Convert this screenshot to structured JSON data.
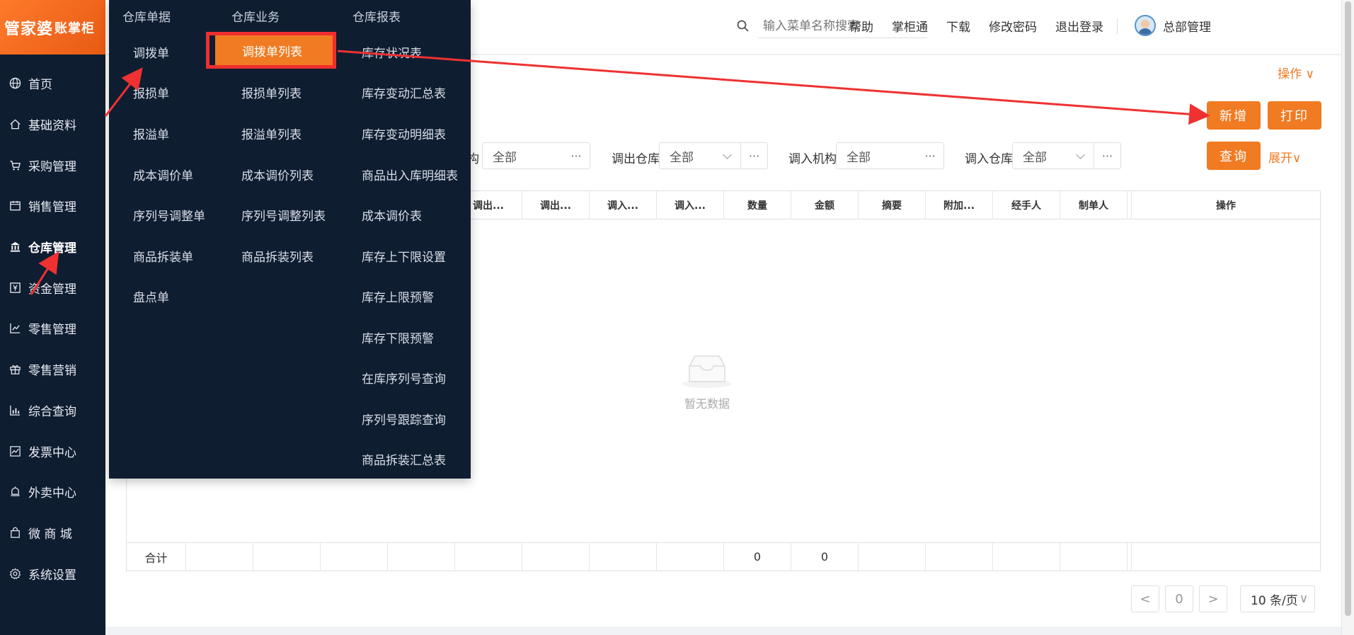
{
  "logo": {
    "main": "管家婆",
    "sub": "账掌柜"
  },
  "sidebar": {
    "items": [
      {
        "label": "首页",
        "icon": "globe-icon"
      },
      {
        "label": "基础资料",
        "icon": "home-icon"
      },
      {
        "label": "采购管理",
        "icon": "cart-icon"
      },
      {
        "label": "销售管理",
        "icon": "calendar-icon"
      },
      {
        "label": "仓库管理",
        "icon": "bank-icon"
      },
      {
        "label": "资金管理",
        "icon": "yen-icon"
      },
      {
        "label": "零售管理",
        "icon": "bar-chart-icon"
      },
      {
        "label": "零售营销",
        "icon": "gift-icon"
      },
      {
        "label": "综合查询",
        "icon": "stats-icon"
      },
      {
        "label": "发票中心",
        "icon": "line-chart-icon"
      },
      {
        "label": "外卖中心",
        "icon": "bell-icon"
      },
      {
        "label": "微 商 城",
        "icon": "bag-icon"
      },
      {
        "label": "系统设置",
        "icon": "gear-icon"
      }
    ],
    "active_index": 4
  },
  "header": {
    "search_placeholder": "输入菜单名称搜索",
    "links": [
      "帮助",
      "掌柜通",
      "下载",
      "修改密码",
      "退出登录"
    ],
    "user": "总部管理"
  },
  "tabbar": {
    "op_label": "操作 ∨"
  },
  "toolbar": {
    "add_label": "新增",
    "print_label": "打印",
    "query_label": "查询",
    "expand_label": "展开∨"
  },
  "filters": {
    "partial_label": "构",
    "out_org_value": "全部",
    "out_wh_label": "调出仓库",
    "out_wh_value": "全部",
    "in_org_label": "调入机构",
    "in_org_value": "全部",
    "in_wh_label": "调入仓库",
    "in_wh_value": "全部",
    "dots": "···"
  },
  "table": {
    "columns": [
      "调出...",
      "调出...",
      "调入...",
      "调入...",
      "数量",
      "金额",
      "摘要",
      "附加...",
      "经手人",
      "制单人",
      "操作"
    ],
    "empty_text": "暂无数据",
    "footer": {
      "label": "合计",
      "qty": "0",
      "amount": "0"
    }
  },
  "pager": {
    "prev": "<",
    "page": "0",
    "next": ">",
    "size": "10 条/页"
  },
  "mega_menu": {
    "columns": [
      {
        "header": "仓库单据",
        "items": [
          "调拨单",
          "报损单",
          "报溢单",
          "成本调价单",
          "序列号调整单",
          "商品拆装单",
          "盘点单"
        ]
      },
      {
        "header": "仓库业务",
        "items": [
          "调拨单列表",
          "报损单列表",
          "报溢单列表",
          "成本调价列表",
          "序列号调整列表",
          "商品拆装列表"
        ]
      },
      {
        "header": "仓库报表",
        "items": [
          "库存状况表",
          "库存变动汇总表",
          "库存变动明细表",
          "商品出入库明细表",
          "成本调价表",
          "库存上下限设置",
          "库存上限预警",
          "库存下限预警",
          "在库序列号查询",
          "序列号跟踪查询",
          "商品拆装汇总表"
        ]
      }
    ],
    "active": "调拨单列表"
  },
  "colors": {
    "accent": "#f07b22",
    "sidebar": "#0f1d31",
    "highlight_box": "#ef2f2f"
  }
}
